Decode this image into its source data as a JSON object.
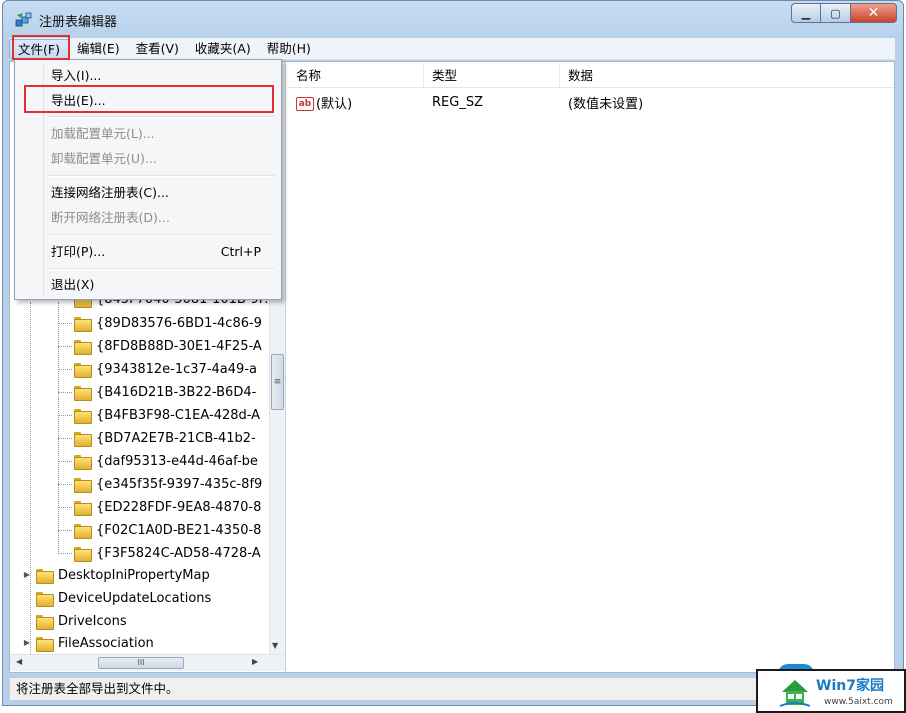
{
  "window": {
    "title": "注册表编辑器",
    "min_glyph": "▁",
    "max_glyph": "▢",
    "close_glyph": "✕"
  },
  "menubar": {
    "items": [
      "文件(F)",
      "编辑(E)",
      "查看(V)",
      "收藏夹(A)",
      "帮助(H)"
    ]
  },
  "file_menu": {
    "items": [
      {
        "label": "导入(I)...",
        "enabled": true
      },
      {
        "label": "导出(E)...",
        "enabled": true
      },
      {
        "label": "加载配置单元(L)...",
        "enabled": false
      },
      {
        "label": "卸载配置单元(U)...",
        "enabled": false
      },
      {
        "label": "连接网络注册表(C)...",
        "enabled": true
      },
      {
        "label": "断开网络注册表(D)...",
        "enabled": false
      },
      {
        "label": "打印(P)...",
        "enabled": true,
        "shortcut": "Ctrl+P"
      },
      {
        "label": "退出(X)",
        "enabled": true
      }
    ]
  },
  "tree": {
    "partial_top": "{845F7040-5081-101B-9F...",
    "guid_items": [
      "{89D83576-6BD1-4c86-9",
      "{8FD8B88D-30E1-4F25-A",
      "{9343812e-1c37-4a49-a",
      "{B416D21B-3B22-B6D4-",
      "{B4FB3F98-C1EA-428d-A",
      "{BD7A2E7B-21CB-41b2-",
      "{daf95313-e44d-46af-be",
      "{e345f35f-9397-435c-8f9",
      "{ED228FDF-9EA8-4870-8",
      "{F02C1A0D-BE21-4350-8",
      "{F3F5824C-AD58-4728-A"
    ],
    "root_items": [
      {
        "label": "DesktopIniPropertyMap",
        "expandable": true
      },
      {
        "label": "DeviceUpdateLocations",
        "expandable": false
      },
      {
        "label": "DriveIcons",
        "expandable": false
      },
      {
        "label": "FileAssociation",
        "expandable": true
      }
    ]
  },
  "list": {
    "columns": [
      "名称",
      "类型",
      "数据"
    ],
    "rows": [
      {
        "name": "(默认)",
        "type": "REG_SZ",
        "data": "(数值未设置)"
      }
    ],
    "value_icon_text": "ab"
  },
  "status": {
    "text": "将注册表全部导出到文件中。"
  },
  "watermark": {
    "brand": "Win7家园",
    "url": "www.5aixt.com"
  },
  "scroll": {
    "thumb_glyph": "≡",
    "hthumb_glyph": "III",
    "left_arrow": "◀",
    "right_arrow": "▶",
    "down_arrow": "▼"
  },
  "colors": {
    "highlight_red": "#e03030",
    "watermark_blue": "#1a7bc4"
  }
}
